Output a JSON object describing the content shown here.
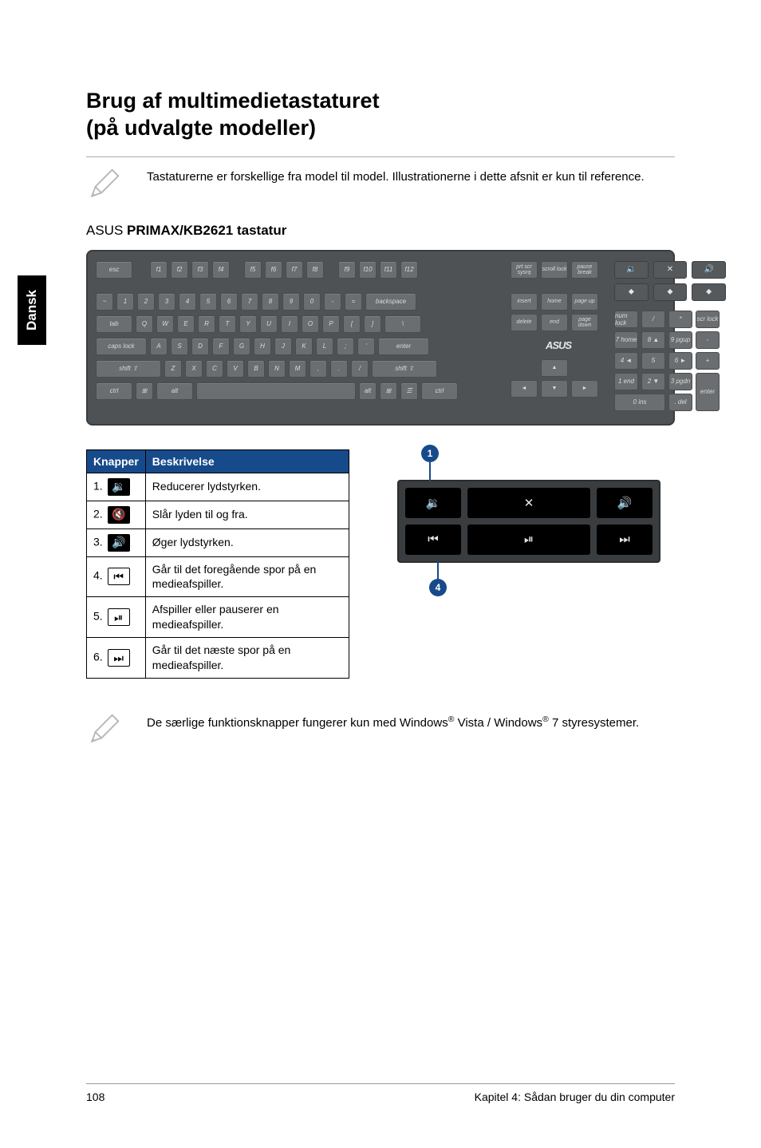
{
  "side_tab": "Dansk",
  "heading_line1": "Brug af multimedietastaturet",
  "heading_line2": "(på udvalgte modeller)",
  "note1": "Tastaturerne er forskellige fra model til model. Illustrationerne i dette afsnit er kun til reference.",
  "subheading_brand": "ASUS",
  "subheading_model": "PRIMAX/KB2621 tastatur",
  "keyboard": {
    "row_fn": [
      "esc",
      "f1",
      "f2",
      "f3",
      "f4",
      "f5",
      "f6",
      "f7",
      "f8",
      "f9",
      "f10",
      "f11",
      "f12"
    ],
    "row_num": [
      "~",
      "1",
      "2",
      "3",
      "4",
      "5",
      "6",
      "7",
      "8",
      "9",
      "0",
      "-",
      "=",
      "backspace"
    ],
    "row_q": [
      "tab",
      "Q",
      "W",
      "E",
      "R",
      "T",
      "Y",
      "U",
      "I",
      "O",
      "P",
      "[",
      "]",
      "\\"
    ],
    "row_a": [
      "caps lock",
      "A",
      "S",
      "D",
      "F",
      "G",
      "H",
      "J",
      "K",
      "L",
      ";",
      "'",
      "enter"
    ],
    "row_z": [
      "shift ⇧",
      "Z",
      "X",
      "C",
      "V",
      "B",
      "N",
      "M",
      ",",
      ".",
      "/",
      "shift ⇧"
    ],
    "row_ctrl": [
      "ctrl",
      "⊞",
      "alt",
      "",
      "alt",
      "⊞",
      "☰",
      "ctrl"
    ],
    "nav_top": [
      "prt scr sysrq",
      "scroll lock",
      "pause break"
    ],
    "nav_mid1": [
      "insert",
      "home",
      "page up"
    ],
    "nav_mid2": [
      "delete",
      "end",
      "page down"
    ],
    "arrows": [
      "◄",
      "▲",
      "▼",
      "►"
    ],
    "logo": "ASUS",
    "numpad": [
      "num lock",
      "/",
      "*",
      "scr lock",
      "7 home",
      "8 ▲",
      "9 pgup",
      "-",
      "4 ◄",
      "5",
      "6 ►",
      "+",
      "1 end",
      "2 ▼",
      "3 pgdn",
      "enter",
      "0 ins",
      ". del"
    ],
    "media_top": [
      "🔉",
      "✕",
      "🔊"
    ],
    "leds": [
      "⬥",
      "⬥",
      "⬥"
    ]
  },
  "table": {
    "head_col1": "Knapper",
    "head_col2": "Beskrivelse",
    "rows": [
      {
        "n": "1.",
        "icon": "vol-down",
        "desc": "Reducerer lydstyrken."
      },
      {
        "n": "2.",
        "icon": "mute",
        "desc": "Slår lyden til og fra."
      },
      {
        "n": "3.",
        "icon": "vol-up",
        "desc": "Øger lydstyrken."
      },
      {
        "n": "4.",
        "icon": "prev",
        "desc": "Går til det foregående spor på en medieafspiller."
      },
      {
        "n": "5.",
        "icon": "play-pause",
        "desc": "Afspiller eller pauserer en medieafspiller."
      },
      {
        "n": "6.",
        "icon": "next",
        "desc": "Går til det næste spor på en medieafspiller."
      }
    ]
  },
  "diagram": {
    "bubble_top": "1",
    "bubble_bottom": "4",
    "buttons": [
      "🔉",
      "✕",
      "🔊",
      "⏮",
      "⏯",
      "⏭"
    ]
  },
  "note2_pre": "De særlige funktionsknapper fungerer kun med Windows",
  "note2_mid": " Vista / Windows",
  "note2_post": " 7 styresystemer.",
  "reg": "®",
  "footer_left": "108",
  "footer_right": "Kapitel 4: Sådan bruger du din computer"
}
